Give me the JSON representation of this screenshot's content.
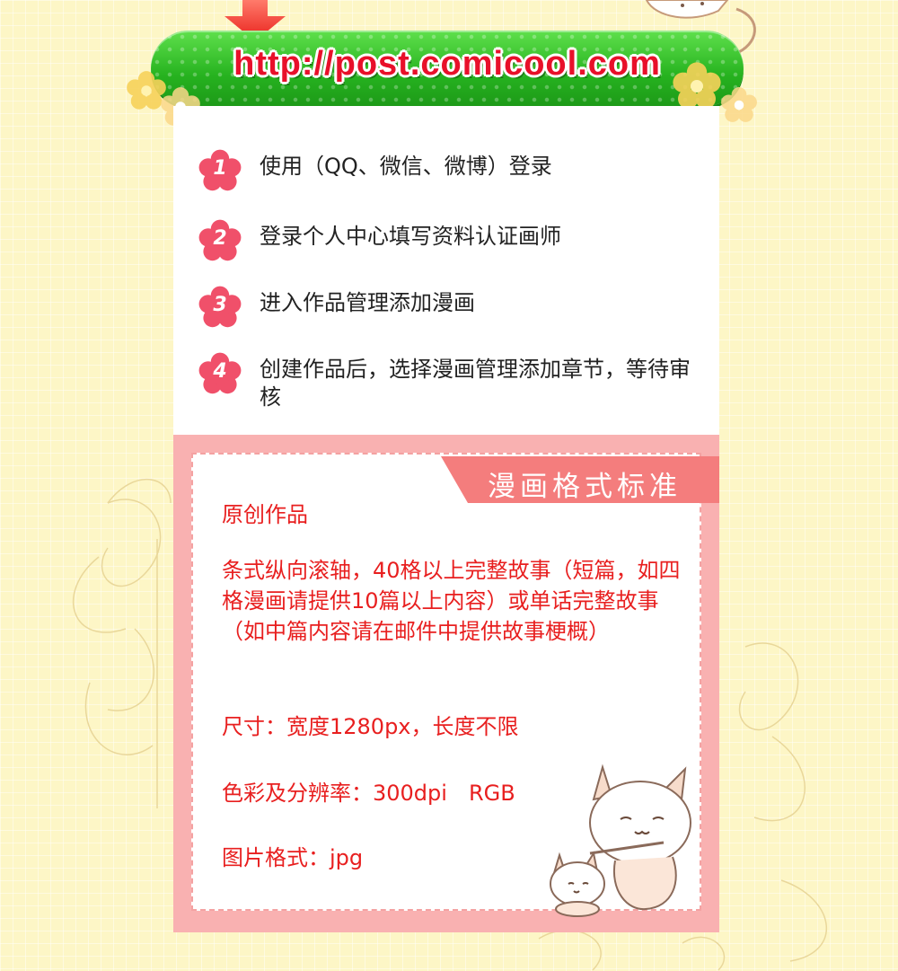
{
  "banner": {
    "url": "http://post.comicool.com"
  },
  "steps": [
    {
      "number": "1",
      "text": "使用（QQ、微信、微博）登录"
    },
    {
      "number": "2",
      "text": "登录个人中心填写资料认证画师"
    },
    {
      "number": "3",
      "text": "进入作品管理添加漫画"
    },
    {
      "number": "4",
      "text": "创建作品后，选择漫画管理添加章节，等待审核"
    }
  ],
  "format": {
    "title": "漫画格式标准",
    "category": "原创作品",
    "description": "条式纵向滚轴，40格以上完整故事（短篇，如四格漫画请提供10篇以上内容）或单话完整故事（如中篇内容请在邮件中提供故事梗概）",
    "size": "尺寸：宽度1280px，长度不限",
    "color": "色彩及分辨率：300dpi　RGB",
    "image_format": "图片格式：jpg"
  },
  "colors": {
    "background": "#fdf6c6",
    "banner_green": "#26b21f",
    "url_red": "#e8102a",
    "panel_pink": "#f9b1b1",
    "title_pink": "#f47d7d",
    "step_badge": "#f0506a",
    "format_text": "#e81f1f"
  },
  "icons": {
    "arrow": "down-arrow-icon",
    "step_badge": "flower-badge-icon",
    "decoration": "flower-icon",
    "mascot": "cat-mascot-icon"
  }
}
